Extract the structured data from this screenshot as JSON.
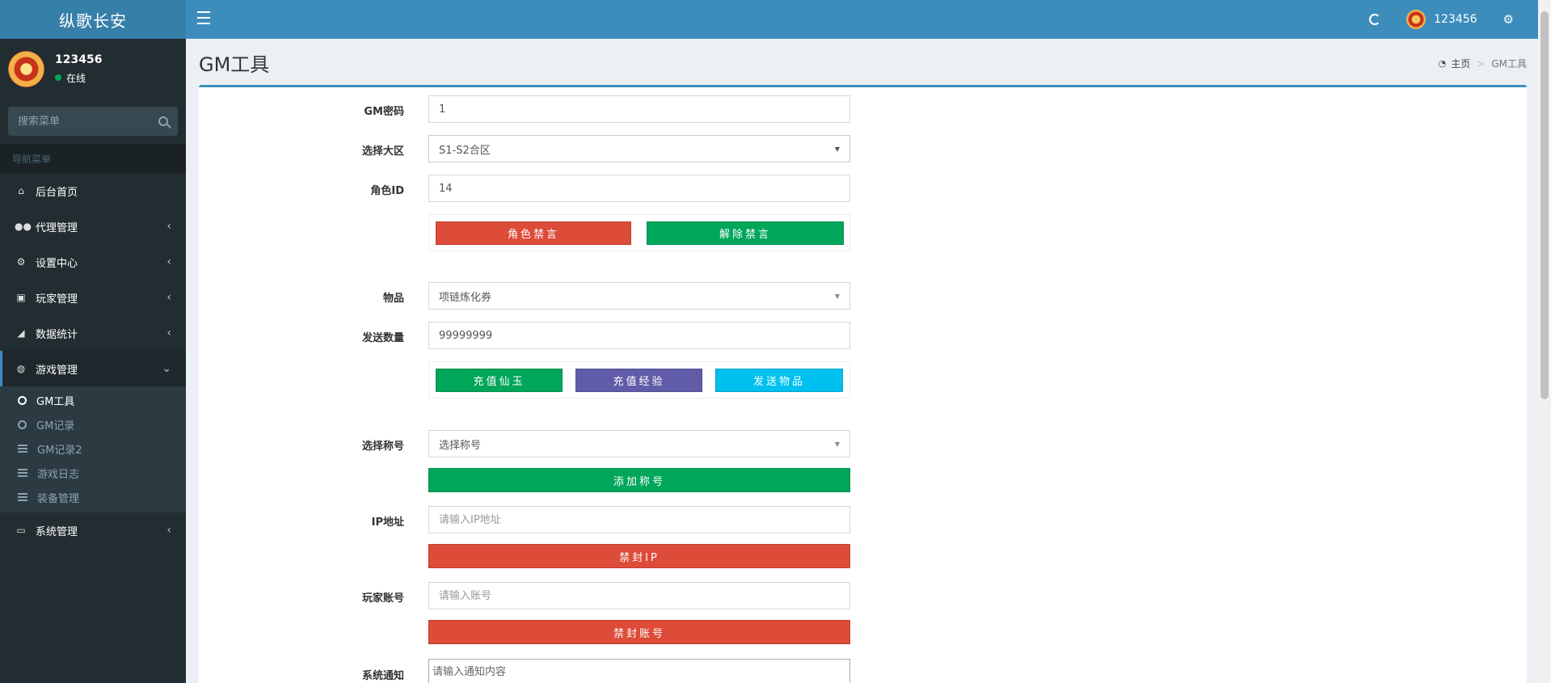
{
  "app": {
    "title": "纵歌长安"
  },
  "navbar": {
    "username": "123456"
  },
  "sidebar": {
    "user_name": "123456",
    "user_status": "在线",
    "search_placeholder": "搜索菜单",
    "nav_header": "导航菜单",
    "items": [
      {
        "label": "后台首页",
        "icon": "home-icon"
      },
      {
        "label": "代理管理",
        "icon": "users-icon"
      },
      {
        "label": "设置中心",
        "icon": "gears-icon"
      },
      {
        "label": "玩家管理",
        "icon": "contact-icon"
      },
      {
        "label": "数据统计",
        "icon": "area-chart-icon"
      },
      {
        "label": "游戏管理",
        "icon": "gamepad-icon"
      },
      {
        "label": "系统管理",
        "icon": "desktop-icon"
      }
    ],
    "submenu": [
      {
        "label": "GM工具",
        "icon": "circle-icon"
      },
      {
        "label": "GM记录",
        "icon": "circle-icon"
      },
      {
        "label": "GM记录2",
        "icon": "list-icon"
      },
      {
        "label": "游戏日志",
        "icon": "list-icon"
      },
      {
        "label": "装备管理",
        "icon": "list-icon"
      }
    ]
  },
  "page": {
    "title": "GM工具",
    "breadcrumb_home": "主页",
    "breadcrumb_current": "GM工具"
  },
  "form": {
    "gm_password": {
      "label": "GM密码",
      "value": "1"
    },
    "server": {
      "label": "选择大区",
      "value": "S1-S2合区"
    },
    "role_id": {
      "label": "角色ID",
      "value": "14"
    },
    "mute_button": "角色禁言",
    "unmute_button": "解除禁言",
    "item": {
      "label": "物品",
      "value": "项链炼化券"
    },
    "quantity": {
      "label": "发送数量",
      "value": "99999999"
    },
    "recharge_jade_button": "充值仙玉",
    "recharge_exp_button": "充值经验",
    "send_item_button": "发送物品",
    "title_select": {
      "label": "选择称号",
      "value": "选择称号"
    },
    "add_title_button": "添加称号",
    "ip": {
      "label": "IP地址",
      "placeholder": "请输入IP地址"
    },
    "ban_ip_button": "禁封IP",
    "account": {
      "label": "玩家账号",
      "placeholder": "请输入账号"
    },
    "ban_account_button": "禁封账号",
    "notice": {
      "label": "系统通知",
      "placeholder": "请输入通知内容"
    }
  },
  "colors": {
    "header": "#3c8dbc",
    "logo_bg": "#367fa9",
    "sidebar": "#222d32",
    "red": "#dd4b39",
    "green": "#00a65a",
    "purple": "#605ca8",
    "cyan": "#00c0ef"
  }
}
